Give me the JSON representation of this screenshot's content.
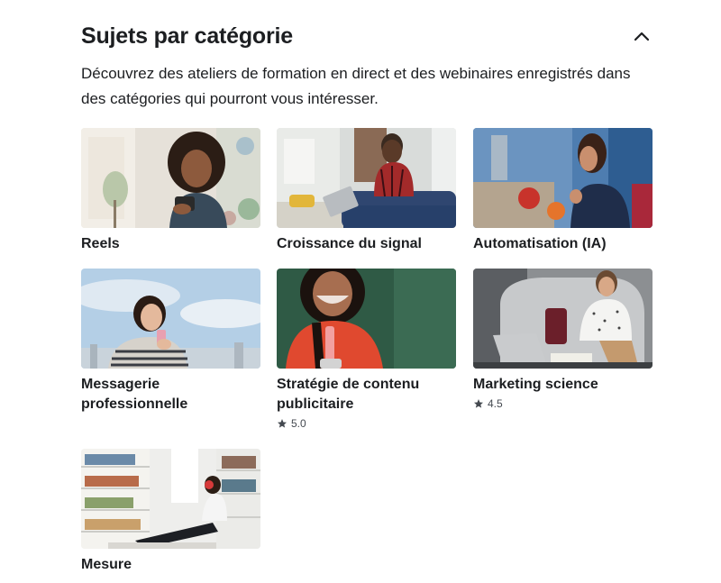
{
  "section": {
    "title": "Sujets par catégorie",
    "description": " Découvrez des ateliers de formation en direct et des webinaires enregistrés dans des catégories qui pourront vous intéresser.",
    "collapse_icon": "chevron-up-icon"
  },
  "cards": [
    {
      "title": "Reels",
      "rating": null
    },
    {
      "title": "Croissance du signal",
      "rating": null
    },
    {
      "title": "Automatisation (IA)",
      "rating": null
    },
    {
      "title": "Messagerie professionnelle",
      "rating": null
    },
    {
      "title": "Stratégie de contenu publicitaire",
      "rating": "5.0"
    },
    {
      "title": "Marketing science",
      "rating": "4.5"
    },
    {
      "title": "Mesure",
      "rating": null
    }
  ],
  "icons": {
    "rating": "star-icon"
  },
  "colors": {
    "text": "#1c1e21",
    "secondary_text": "#444950",
    "background": "#ffffff"
  }
}
